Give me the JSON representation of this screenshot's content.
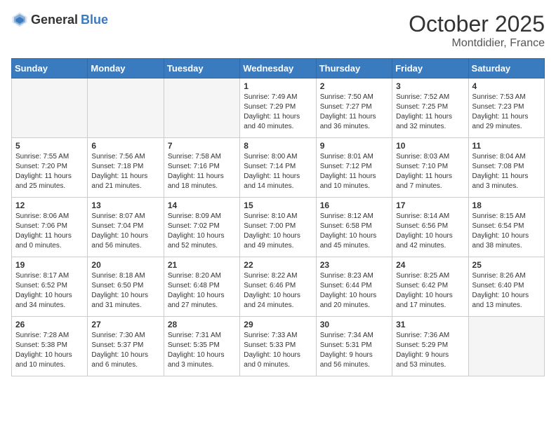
{
  "header": {
    "logo_general": "General",
    "logo_blue": "Blue",
    "month": "October 2025",
    "location": "Montdidier, France"
  },
  "weekdays": [
    "Sunday",
    "Monday",
    "Tuesday",
    "Wednesday",
    "Thursday",
    "Friday",
    "Saturday"
  ],
  "weeks": [
    [
      {
        "day": "",
        "info": "",
        "empty": true
      },
      {
        "day": "",
        "info": "",
        "empty": true
      },
      {
        "day": "",
        "info": "",
        "empty": true
      },
      {
        "day": "1",
        "info": "Sunrise: 7:49 AM\nSunset: 7:29 PM\nDaylight: 11 hours\nand 40 minutes.",
        "empty": false
      },
      {
        "day": "2",
        "info": "Sunrise: 7:50 AM\nSunset: 7:27 PM\nDaylight: 11 hours\nand 36 minutes.",
        "empty": false
      },
      {
        "day": "3",
        "info": "Sunrise: 7:52 AM\nSunset: 7:25 PM\nDaylight: 11 hours\nand 32 minutes.",
        "empty": false
      },
      {
        "day": "4",
        "info": "Sunrise: 7:53 AM\nSunset: 7:23 PM\nDaylight: 11 hours\nand 29 minutes.",
        "empty": false
      }
    ],
    [
      {
        "day": "5",
        "info": "Sunrise: 7:55 AM\nSunset: 7:20 PM\nDaylight: 11 hours\nand 25 minutes.",
        "empty": false
      },
      {
        "day": "6",
        "info": "Sunrise: 7:56 AM\nSunset: 7:18 PM\nDaylight: 11 hours\nand 21 minutes.",
        "empty": false
      },
      {
        "day": "7",
        "info": "Sunrise: 7:58 AM\nSunset: 7:16 PM\nDaylight: 11 hours\nand 18 minutes.",
        "empty": false
      },
      {
        "day": "8",
        "info": "Sunrise: 8:00 AM\nSunset: 7:14 PM\nDaylight: 11 hours\nand 14 minutes.",
        "empty": false
      },
      {
        "day": "9",
        "info": "Sunrise: 8:01 AM\nSunset: 7:12 PM\nDaylight: 11 hours\nand 10 minutes.",
        "empty": false
      },
      {
        "day": "10",
        "info": "Sunrise: 8:03 AM\nSunset: 7:10 PM\nDaylight: 11 hours\nand 7 minutes.",
        "empty": false
      },
      {
        "day": "11",
        "info": "Sunrise: 8:04 AM\nSunset: 7:08 PM\nDaylight: 11 hours\nand 3 minutes.",
        "empty": false
      }
    ],
    [
      {
        "day": "12",
        "info": "Sunrise: 8:06 AM\nSunset: 7:06 PM\nDaylight: 11 hours\nand 0 minutes.",
        "empty": false
      },
      {
        "day": "13",
        "info": "Sunrise: 8:07 AM\nSunset: 7:04 PM\nDaylight: 10 hours\nand 56 minutes.",
        "empty": false
      },
      {
        "day": "14",
        "info": "Sunrise: 8:09 AM\nSunset: 7:02 PM\nDaylight: 10 hours\nand 52 minutes.",
        "empty": false
      },
      {
        "day": "15",
        "info": "Sunrise: 8:10 AM\nSunset: 7:00 PM\nDaylight: 10 hours\nand 49 minutes.",
        "empty": false
      },
      {
        "day": "16",
        "info": "Sunrise: 8:12 AM\nSunset: 6:58 PM\nDaylight: 10 hours\nand 45 minutes.",
        "empty": false
      },
      {
        "day": "17",
        "info": "Sunrise: 8:14 AM\nSunset: 6:56 PM\nDaylight: 10 hours\nand 42 minutes.",
        "empty": false
      },
      {
        "day": "18",
        "info": "Sunrise: 8:15 AM\nSunset: 6:54 PM\nDaylight: 10 hours\nand 38 minutes.",
        "empty": false
      }
    ],
    [
      {
        "day": "19",
        "info": "Sunrise: 8:17 AM\nSunset: 6:52 PM\nDaylight: 10 hours\nand 34 minutes.",
        "empty": false
      },
      {
        "day": "20",
        "info": "Sunrise: 8:18 AM\nSunset: 6:50 PM\nDaylight: 10 hours\nand 31 minutes.",
        "empty": false
      },
      {
        "day": "21",
        "info": "Sunrise: 8:20 AM\nSunset: 6:48 PM\nDaylight: 10 hours\nand 27 minutes.",
        "empty": false
      },
      {
        "day": "22",
        "info": "Sunrise: 8:22 AM\nSunset: 6:46 PM\nDaylight: 10 hours\nand 24 minutes.",
        "empty": false
      },
      {
        "day": "23",
        "info": "Sunrise: 8:23 AM\nSunset: 6:44 PM\nDaylight: 10 hours\nand 20 minutes.",
        "empty": false
      },
      {
        "day": "24",
        "info": "Sunrise: 8:25 AM\nSunset: 6:42 PM\nDaylight: 10 hours\nand 17 minutes.",
        "empty": false
      },
      {
        "day": "25",
        "info": "Sunrise: 8:26 AM\nSunset: 6:40 PM\nDaylight: 10 hours\nand 13 minutes.",
        "empty": false
      }
    ],
    [
      {
        "day": "26",
        "info": "Sunrise: 7:28 AM\nSunset: 5:38 PM\nDaylight: 10 hours\nand 10 minutes.",
        "empty": false
      },
      {
        "day": "27",
        "info": "Sunrise: 7:30 AM\nSunset: 5:37 PM\nDaylight: 10 hours\nand 6 minutes.",
        "empty": false
      },
      {
        "day": "28",
        "info": "Sunrise: 7:31 AM\nSunset: 5:35 PM\nDaylight: 10 hours\nand 3 minutes.",
        "empty": false
      },
      {
        "day": "29",
        "info": "Sunrise: 7:33 AM\nSunset: 5:33 PM\nDaylight: 10 hours\nand 0 minutes.",
        "empty": false
      },
      {
        "day": "30",
        "info": "Sunrise: 7:34 AM\nSunset: 5:31 PM\nDaylight: 9 hours\nand 56 minutes.",
        "empty": false
      },
      {
        "day": "31",
        "info": "Sunrise: 7:36 AM\nSunset: 5:29 PM\nDaylight: 9 hours\nand 53 minutes.",
        "empty": false
      },
      {
        "day": "",
        "info": "",
        "empty": true
      }
    ]
  ]
}
